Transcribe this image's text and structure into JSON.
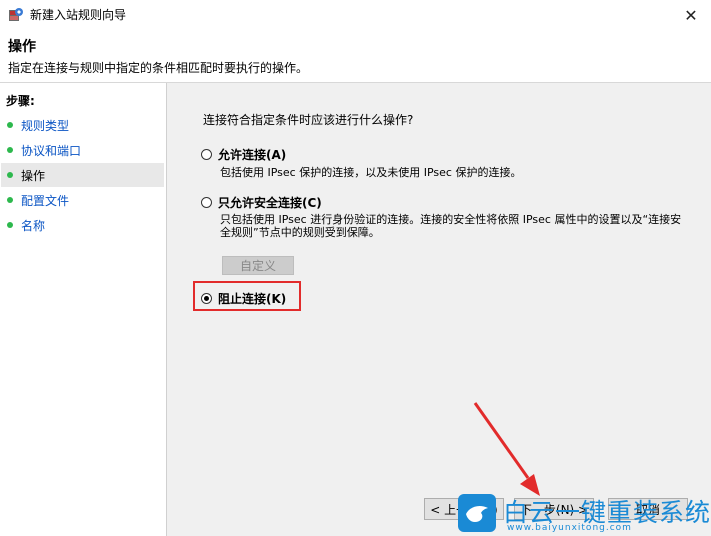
{
  "window": {
    "title": "新建入站规则向导",
    "close_glyph": "✕"
  },
  "header": {
    "title": "操作",
    "description": "指定在连接与规则中指定的条件相匹配时要执行的操作。"
  },
  "sidebar": {
    "steps_title": "步骤:",
    "items": [
      {
        "label": "规则类型",
        "active": false
      },
      {
        "label": "协议和端口",
        "active": false
      },
      {
        "label": "操作",
        "active": true
      },
      {
        "label": "配置文件",
        "active": false
      },
      {
        "label": "名称",
        "active": false
      }
    ]
  },
  "main": {
    "question": "连接符合指定条件时应该进行什么操作?",
    "options": [
      {
        "label": "允许连接(A)",
        "description": "包括使用 IPsec 保护的连接，以及未使用 IPsec 保护的连接。",
        "checked": false
      },
      {
        "label": "只允许安全连接(C)",
        "description": "只包括使用 IPsec 进行身份验证的连接。连接的安全性将依照 IPsec 属性中的设置以及“连接安全规则”节点中的规则受到保障。",
        "checked": false
      },
      {
        "label": "阻止连接(K)",
        "description": "",
        "checked": true
      }
    ],
    "customize_label": "自定义"
  },
  "footer": {
    "back_label": "< 上一步(B)",
    "next_label": "下一步(N) >",
    "cancel_label": "取消"
  },
  "watermark": {
    "text": "白云一键重装系统",
    "url": "www.baiyunxitong.com"
  },
  "colors": {
    "accent_green": "#2db84d",
    "link_blue": "#0b55c4",
    "highlight_red": "#e22b2b",
    "watermark_blue": "#1a8ad5"
  }
}
